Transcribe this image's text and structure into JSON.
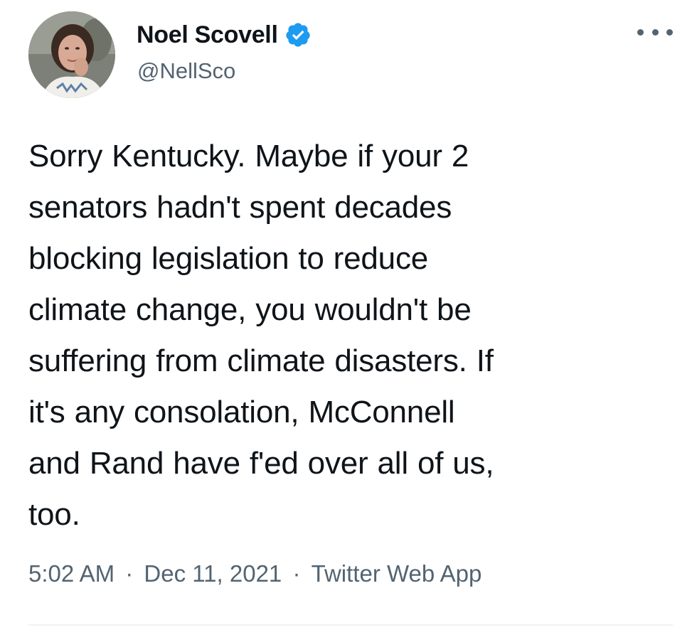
{
  "author": {
    "display_name": "Noel Scovell",
    "handle": "@NellSco",
    "verified": true,
    "avatar_icon": "profile-photo"
  },
  "tweet": {
    "text_lines": [
      "Sorry Kentucky. Maybe if your 2",
      "senators hadn't spent decades",
      "blocking legislation to reduce",
      "climate change, you wouldn't be",
      "suffering from climate disasters. If",
      "it's any consolation, McConnell",
      "and Rand have f'ed over all of us,",
      "too."
    ]
  },
  "meta": {
    "time": "5:02 AM",
    "separator": "·",
    "date": "Dec 11, 2021",
    "source": "Twitter Web App"
  },
  "menu": {
    "icon": "more-horizontal-icon"
  },
  "colors": {
    "text_primary": "#0f1419",
    "text_secondary": "#536471",
    "verified_blue": "#1d9bf0",
    "divider": "#eff3f4"
  }
}
